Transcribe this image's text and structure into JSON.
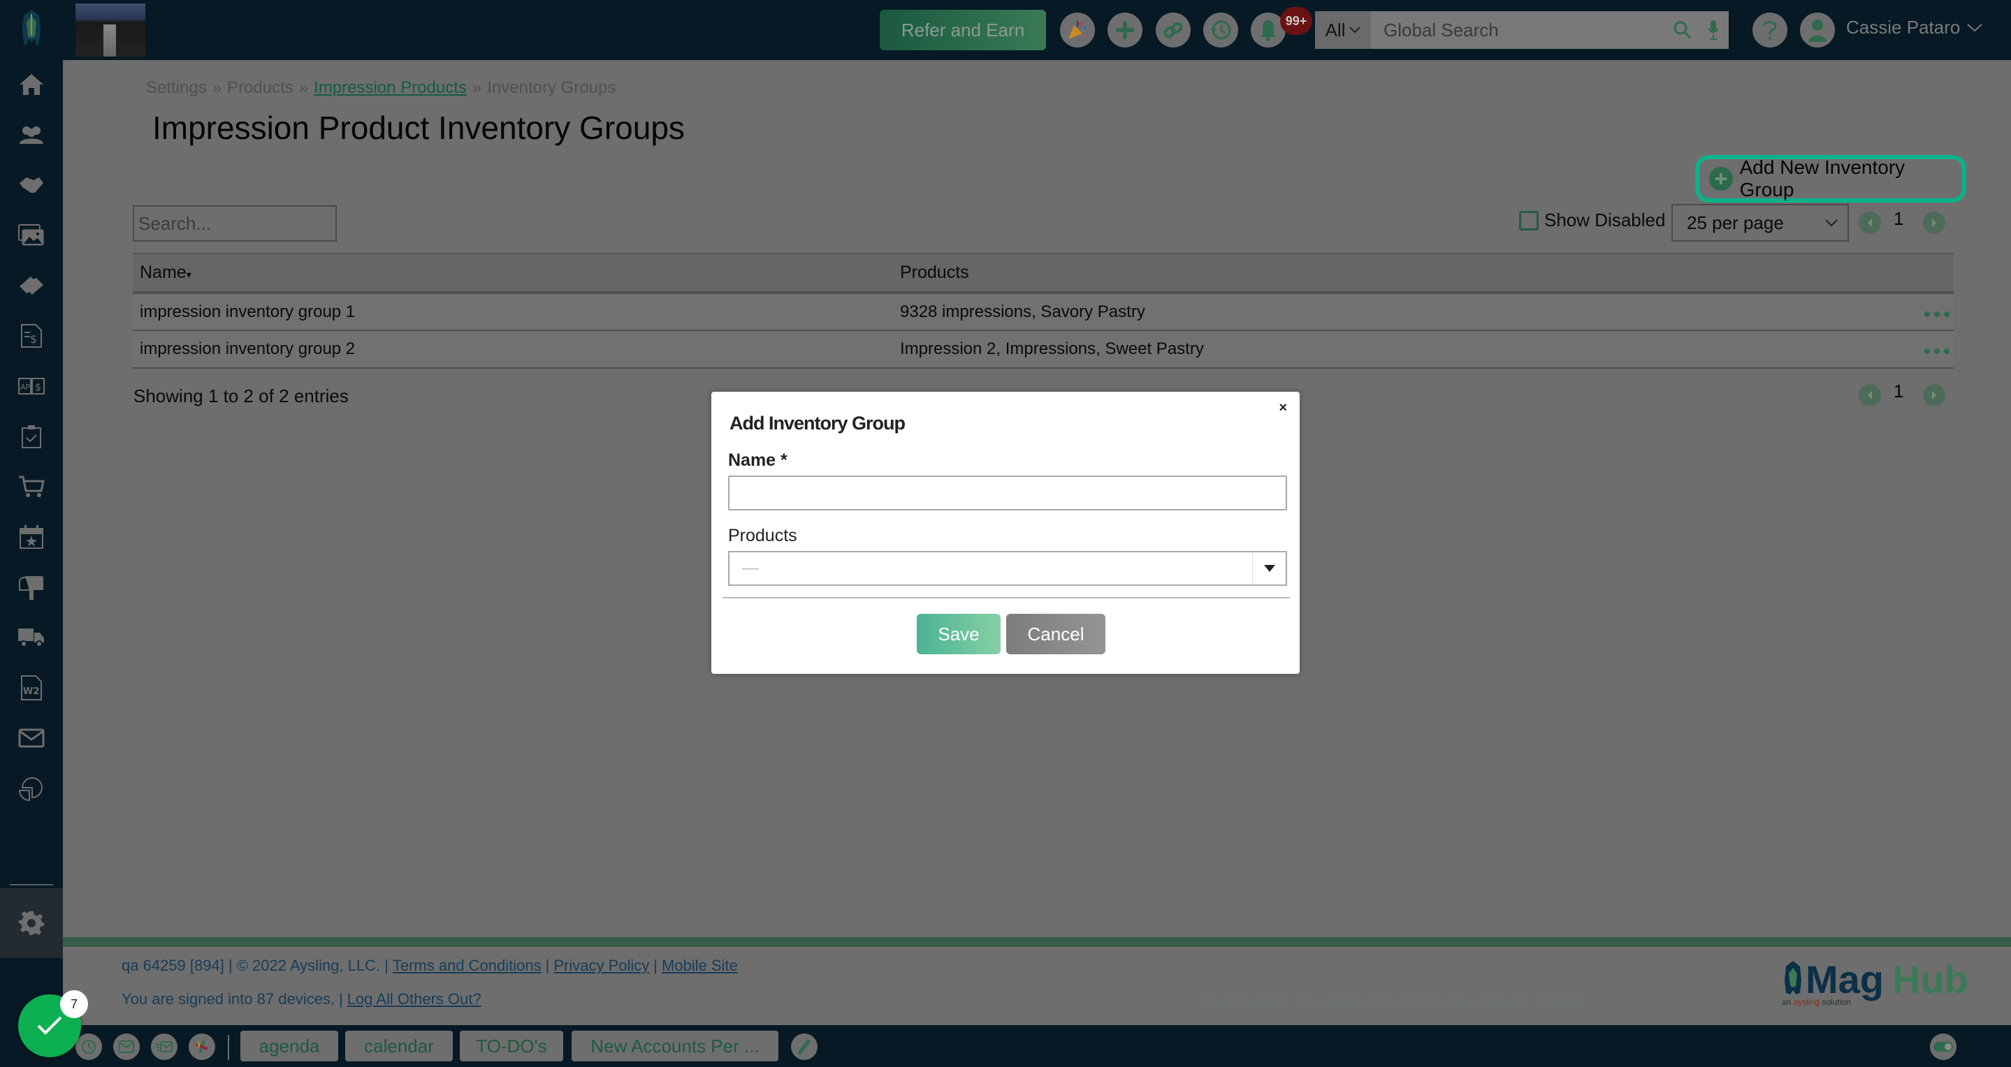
{
  "topbar": {
    "refer_label": "Refer and Earn",
    "notifications_badge": "99+",
    "search_scope": "All",
    "search_placeholder": "Global Search",
    "user_name": "Cassie Pataro",
    "icons": [
      "party-popper-icon",
      "plus-icon",
      "link-icon",
      "history-icon",
      "bell-icon",
      "help-icon",
      "user-avatar-icon"
    ]
  },
  "sidebar": {
    "items": [
      {
        "name": "home",
        "icon": "home-icon"
      },
      {
        "name": "contacts",
        "icon": "people-icon"
      },
      {
        "name": "sales",
        "icon": "handshake-icon"
      },
      {
        "name": "media",
        "icon": "images-icon"
      },
      {
        "name": "tickets",
        "icon": "ticket-icon"
      },
      {
        "name": "invoices",
        "icon": "invoice-icon"
      },
      {
        "name": "ap-billing",
        "icon": "ap-dollar-icon"
      },
      {
        "name": "tasks",
        "icon": "clipboard-check-icon"
      },
      {
        "name": "orders",
        "icon": "cart-icon"
      },
      {
        "name": "events",
        "icon": "calendar-star-icon"
      },
      {
        "name": "mailing",
        "icon": "mailbox-icon"
      },
      {
        "name": "distribution",
        "icon": "truck-icon"
      },
      {
        "name": "tax-forms",
        "icon": "w2-document-icon"
      },
      {
        "name": "email",
        "icon": "envelope-icon"
      },
      {
        "name": "reports",
        "icon": "pie-chart-icon"
      },
      {
        "name": "settings",
        "icon": "gear-icon"
      }
    ]
  },
  "breadcrumb": {
    "items": [
      "Settings",
      "Products",
      "Impression Products",
      "Inventory Groups"
    ],
    "separator": "»"
  },
  "page": {
    "title": "Impression Product Inventory Groups",
    "add_button_label": "Add New Inventory Group",
    "search_placeholder": "Search...",
    "show_disabled_label": "Show Disabled",
    "show_disabled_checked": false,
    "per_page": "25 per page",
    "current_page": "1",
    "entries_info": "Showing 1 to 2 of 2 entries"
  },
  "table": {
    "columns": [
      "Name",
      "Products"
    ],
    "sort_indicator": "▾",
    "rows": [
      {
        "name": "impression inventory group 1",
        "products": "9328 impressions, Savory Pastry"
      },
      {
        "name": "impression inventory group 2",
        "products": "Impression 2, Impressions, Sweet Pastry"
      }
    ]
  },
  "modal": {
    "title": "Add Inventory Group",
    "close_label": "×",
    "name_label": "Name *",
    "name_value": "",
    "products_label": "Products",
    "products_value": "—",
    "save_label": "Save",
    "cancel_label": "Cancel"
  },
  "footer": {
    "build_info": "qa 64259 [894] | © 2022 Aysling, LLC.",
    "links": [
      "Terms and Conditions",
      "Privacy Policy",
      "Mobile Site"
    ],
    "devices_text": "You are signed into 87 devices.",
    "logout_link": "Log All Others Out?",
    "perf_text": "Queries Made: 47 | render time: 0.65s | Max memory: 6.86MB",
    "logo_mag": "Mag",
    "logo_hub": "Hub",
    "logo_tagline_pre": "an ",
    "logo_tagline_brand": "aysling",
    "logo_tagline_post": " solution"
  },
  "taskbar": {
    "todo_count": "7",
    "tabs": [
      "agenda",
      "calendar",
      "TO-DO's",
      "New Accounts Per ..."
    ]
  },
  "colors": {
    "accent": "#07b48a",
    "brand_green": "#2b6a4b",
    "topbar_bg": "#061924",
    "badge_red": "#6a1212",
    "link_blue": "#173c57"
  }
}
